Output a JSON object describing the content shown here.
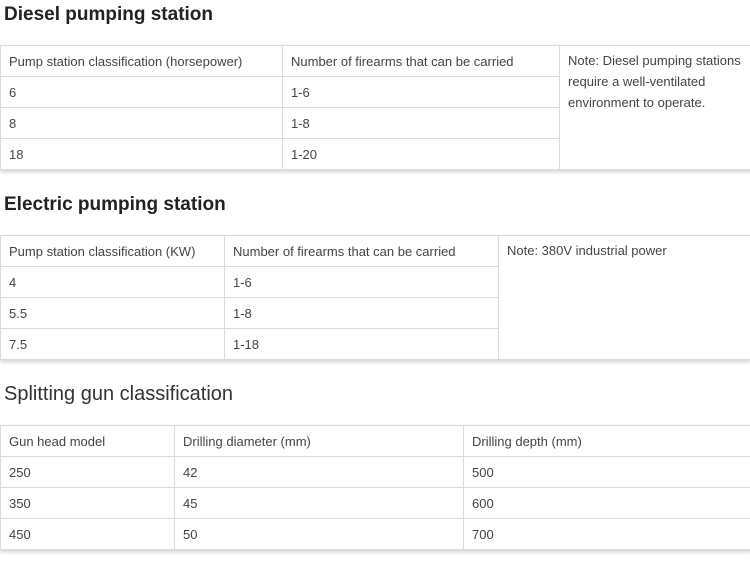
{
  "diesel": {
    "title": "Diesel pumping station",
    "headers": [
      "Pump station classification (horsepower)",
      "Number of firearms that can be carried"
    ],
    "rows": [
      [
        "6",
        "1-6"
      ],
      [
        "8",
        "1-8"
      ],
      [
        "18",
        "1-20"
      ]
    ],
    "note": "Note: Diesel pumping stations require a well-ventilated environment to operate."
  },
  "electric": {
    "title": "Electric pumping station",
    "headers": [
      "Pump station classification (KW)",
      "Number of firearms that can be carried"
    ],
    "rows": [
      [
        "4",
        "1-6"
      ],
      [
        "5.5",
        "1-8"
      ],
      [
        "7.5",
        "1-18"
      ]
    ],
    "note": "Note: 380V industrial power"
  },
  "splitting": {
    "title": "Splitting gun classification",
    "headers": [
      "Gun head model",
      "Drilling diameter (mm)",
      "Drilling depth (mm)"
    ],
    "rows": [
      [
        "250",
        "42",
        "500"
      ],
      [
        "350",
        "45",
        "600"
      ],
      [
        "450",
        "50",
        "700"
      ]
    ]
  }
}
